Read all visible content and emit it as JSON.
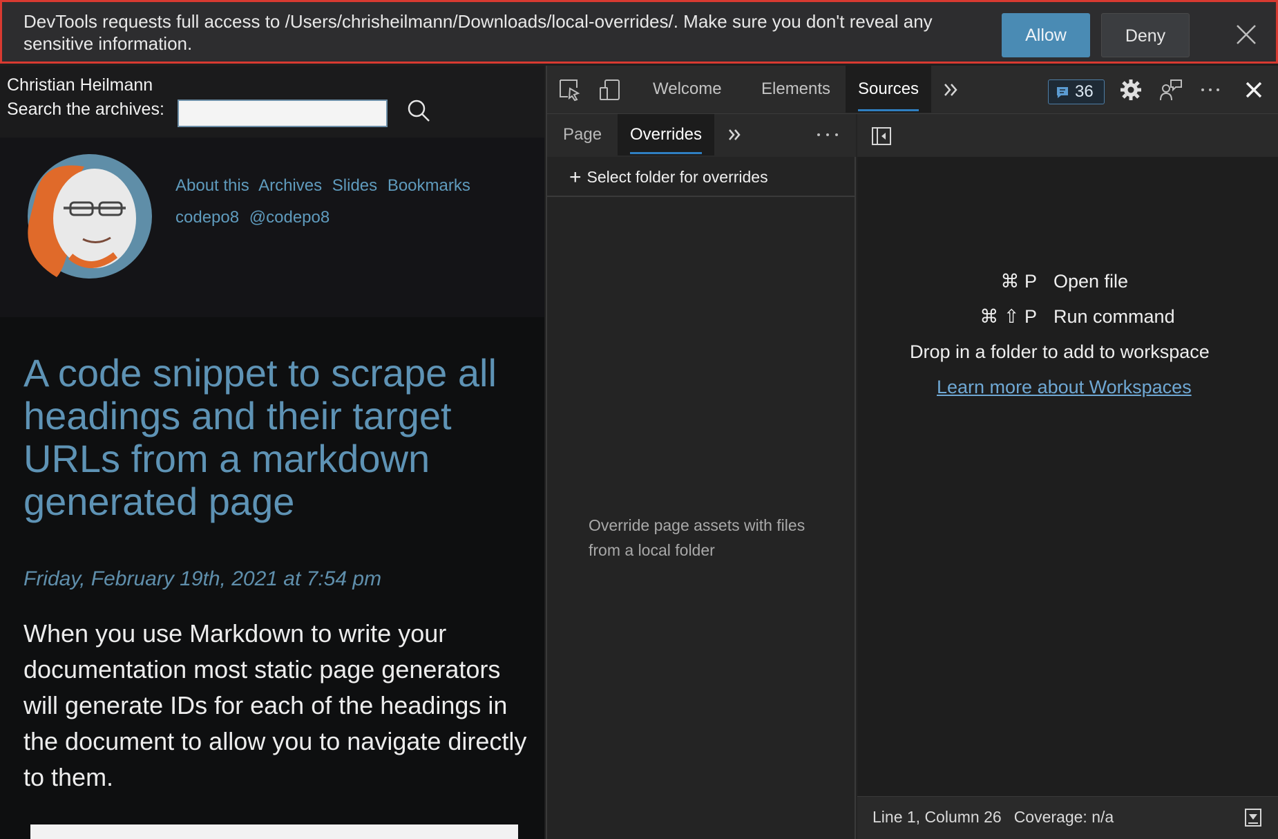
{
  "infobar": {
    "message": "DevTools requests full access to /Users/chrisheilmann/Downloads/local-overrides/. Make sure you don't reveal any sensitive information.",
    "allow_label": "Allow",
    "deny_label": "Deny",
    "border_color": "#d83a31",
    "allow_color": "#4a8bb4"
  },
  "site": {
    "name": "Christian Heilmann",
    "search_label": "Search the archives:",
    "search_value": "",
    "nav_links": [
      "About this",
      "Archives",
      "Slides",
      "Bookmarks"
    ],
    "social_links": [
      "codepo8",
      "@codepo8"
    ],
    "article": {
      "title": "A code snippet to scrape all headings and their target URLs from a markdown generated page",
      "date": "Friday, February 19th, 2021 at 7:54 pm",
      "body": "When you use Markdown to write your documentation most static page generators will generate IDs for each of the headings in the document to allow you to navigate directly to them."
    },
    "link_color": "#5f9bbd"
  },
  "devtools": {
    "tabs": [
      "Welcome",
      "Elements",
      "Sources"
    ],
    "active_tab": "Sources",
    "issues_count": "36",
    "navigator": {
      "tabs": [
        "Page",
        "Overrides"
      ],
      "active_tab": "Overrides",
      "select_folder_label": "Select folder for overrides",
      "hint": "Override page assets with files from a local folder"
    },
    "editor": {
      "shortcuts": [
        {
          "keys": "⌘ P",
          "action": "Open file"
        },
        {
          "keys": "⌘ ⇧ P",
          "action": "Run command"
        }
      ],
      "drop_hint": "Drop in a folder to add to workspace",
      "learn_more": "Learn more about Workspaces"
    },
    "status": {
      "position": "Line 1, Column 26",
      "coverage": "Coverage: n/a"
    },
    "accent_color": "#2f7fc1"
  }
}
